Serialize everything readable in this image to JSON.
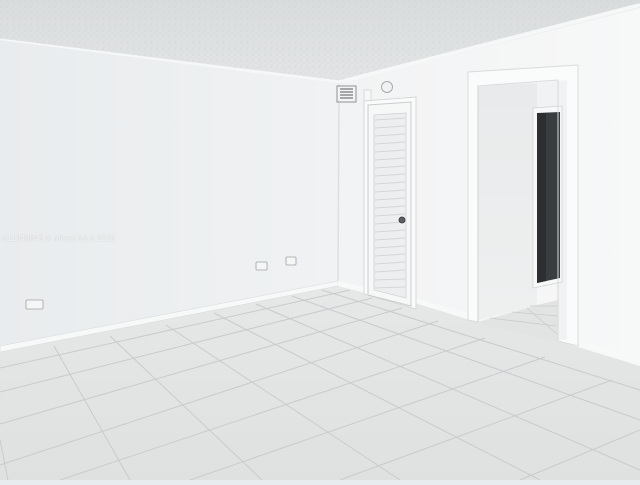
{
  "watermark": {
    "text": "A11843843 © Miami MLS 2025"
  },
  "scene": {
    "description_type": "empty-room-interior",
    "colors": {
      "ceiling": "#dfe2e3",
      "left_wall": "#eef0f1",
      "right_wall": "#f4f5f6",
      "floor_tile": "#e3e5e5",
      "grout": "#c9cccd",
      "door": "#f6f7f7",
      "doorway_interior": "#d8dbdd",
      "hallway_dark": "#3a3d40"
    }
  }
}
